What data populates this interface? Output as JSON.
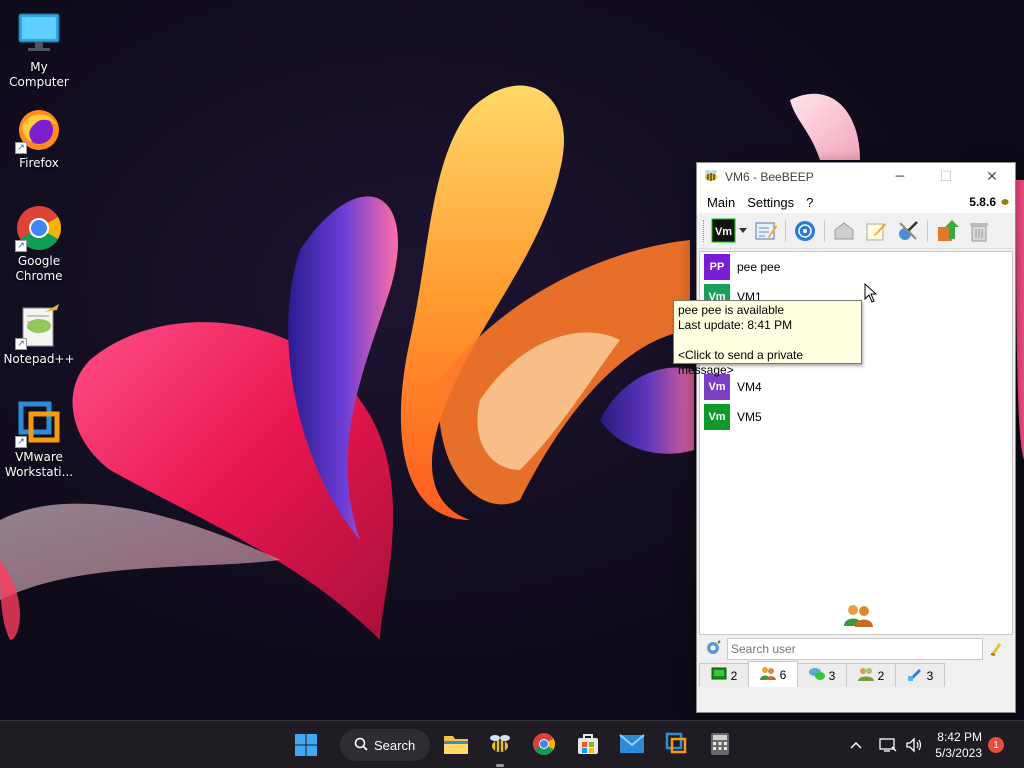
{
  "desktop": {
    "icons": [
      {
        "label": "My Computer"
      },
      {
        "label": "Firefox"
      },
      {
        "label": "Google Chrome"
      },
      {
        "label": "Notepad++"
      },
      {
        "label": "VMware Workstati..."
      }
    ]
  },
  "window": {
    "title": "VM6 - BeeBEEP",
    "minimize": "─",
    "maximize": "☐",
    "close": "✕",
    "menu": [
      "Main",
      "Settings",
      "?"
    ],
    "version": "5.8.6",
    "users": [
      {
        "initials": "PP",
        "name": "pee pee",
        "color": "#7a1bd6"
      },
      {
        "initials": "Vm",
        "name": "VM1",
        "color": "#1aa05a"
      },
      {
        "initials": "Vm",
        "name": "VM4",
        "color": "#7b3fc4"
      },
      {
        "initials": "Vm",
        "name": "VM5",
        "color": "#109a2a"
      }
    ],
    "search_placeholder": "Search user",
    "tabs": [
      {
        "count": "2",
        "icon": "chat-icon"
      },
      {
        "count": "6",
        "icon": "users-icon"
      },
      {
        "count": "3",
        "icon": "groups-icon"
      },
      {
        "count": "2",
        "icon": "network-users-icon"
      },
      {
        "count": "3",
        "icon": "files-icon"
      }
    ]
  },
  "tooltip": {
    "line1": "pee pee is available",
    "line2": "Last update: 8:41 PM",
    "line3": "<Click to send a private message>"
  },
  "taskbar": {
    "search_label": "Search",
    "time": "8:42 PM",
    "date": "5/3/2023",
    "notifications": "1"
  }
}
